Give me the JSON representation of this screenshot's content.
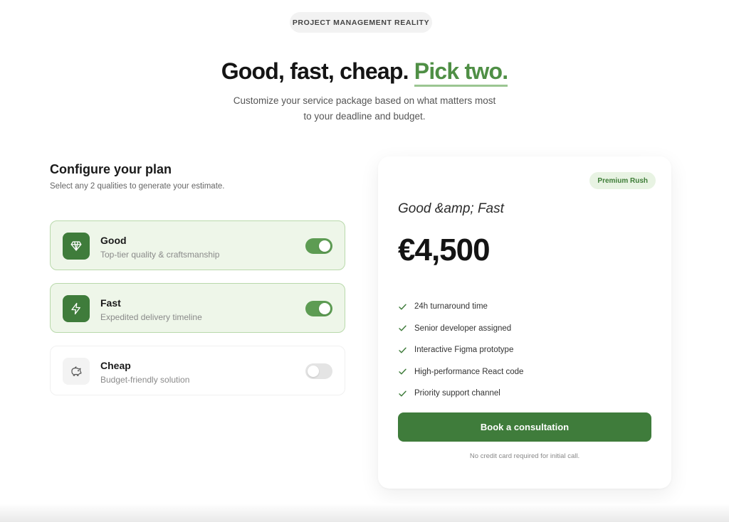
{
  "header": {
    "eyebrow": "PROJECT MANAGEMENT REALITY",
    "headline_main": "Good, fast, cheap.",
    "headline_accent": "Pick two.",
    "subtitle_line1": "Customize your service package based on what matters most",
    "subtitle_line2": "to your deadline and budget."
  },
  "config": {
    "title": "Configure your plan",
    "subtitle": "Select any 2 qualities to generate your estimate.",
    "options": [
      {
        "title": "Good",
        "description": "Top-tier quality & craftsmanship",
        "icon": "diamond-icon",
        "enabled": true
      },
      {
        "title": "Fast",
        "description": "Expedited delivery timeline",
        "icon": "lightning-icon",
        "enabled": true
      },
      {
        "title": "Cheap",
        "description": "Budget-friendly solution",
        "icon": "piggy-bank-icon",
        "enabled": false
      }
    ]
  },
  "summary": {
    "badge": "Premium Rush",
    "plan_name": "Good &amp; Fast",
    "price": "€4,500",
    "features": [
      "24h turnaround time",
      "Senior developer assigned",
      "Interactive Figma prototype",
      "High-performance React code",
      "Priority support channel"
    ],
    "cta_label": "Book a consultation",
    "note": "No credit card required for initial call."
  },
  "colors": {
    "accent": "#4f8f45",
    "button": "#3f7c3b",
    "active_bg": "#eef6e9",
    "toggle_on": "#5d9c53"
  }
}
